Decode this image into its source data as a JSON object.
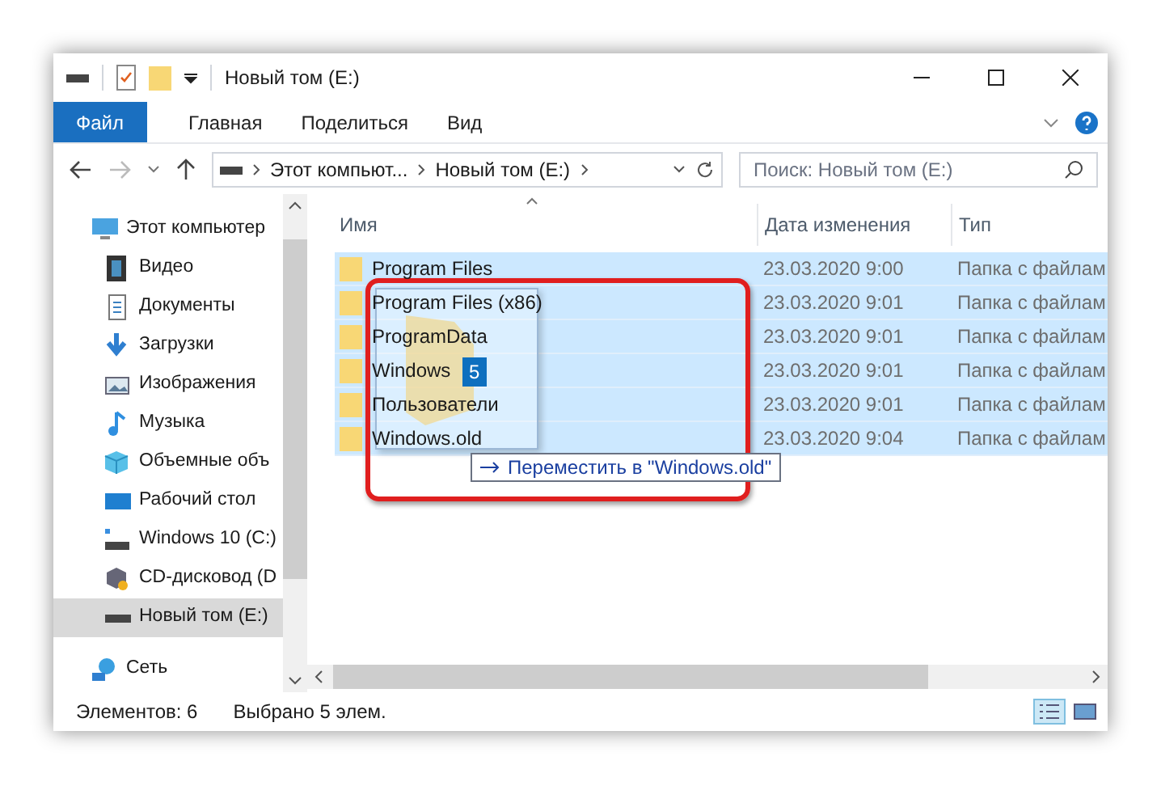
{
  "window": {
    "title": "Новый том (E:)"
  },
  "ribbon": {
    "tabs": [
      {
        "label": "Файл",
        "selected": true
      },
      {
        "label": "Главная",
        "selected": false
      },
      {
        "label": "Поделиться",
        "selected": false
      },
      {
        "label": "Вид",
        "selected": false
      }
    ]
  },
  "address_bar": {
    "path": [
      "Этот компьют...",
      "Новый том (E:)"
    ],
    "search": {
      "placeholder": "Поиск: Новый том (E:)"
    }
  },
  "sidebar": {
    "items": [
      {
        "label": "Этот компьютер",
        "kind": "pc",
        "selected": false,
        "children": [
          {
            "label": "Видео",
            "kind": "video",
            "selected": false
          },
          {
            "label": "Документы",
            "kind": "docs",
            "selected": false
          },
          {
            "label": "Загрузки",
            "kind": "down",
            "selected": false
          },
          {
            "label": "Изображения",
            "kind": "image",
            "selected": false
          },
          {
            "label": "Музыка",
            "kind": "music",
            "selected": false
          },
          {
            "label": "Объемные объ",
            "kind": "cube",
            "selected": false
          },
          {
            "label": "Рабочий стол",
            "kind": "desk",
            "selected": false
          },
          {
            "label": "Windows 10 (C:)",
            "kind": "sysdrive",
            "selected": false
          },
          {
            "label": "CD-дисковод (D",
            "kind": "cd",
            "selected": false
          },
          {
            "label": "Новый том (E:)",
            "kind": "drive",
            "selected": true
          }
        ]
      },
      {
        "label": "Сеть",
        "kind": "net",
        "selected": false
      }
    ]
  },
  "table": {
    "columns": [
      "Имя",
      "Дата изменения",
      "Тип"
    ],
    "rows": [
      {
        "name": "Program Files",
        "date": "23.03.2020 9:00",
        "type": "Папка с файлам",
        "selected": true
      },
      {
        "name": "Program Files (x86)",
        "date": "23.03.2020 9:01",
        "type": "Папка с файлам",
        "selected": true
      },
      {
        "name": "ProgramData",
        "date": "23.03.2020 9:01",
        "type": "Папка с файлам",
        "selected": true
      },
      {
        "name": "Windows",
        "date": "23.03.2020 9:01",
        "type": "Папка с файлам",
        "selected": true
      },
      {
        "name": "Пользователи",
        "date": "23.03.2020 9:01",
        "type": "Папка с файлам",
        "selected": true
      },
      {
        "name": "Windows.old",
        "date": "23.03.2020 9:04",
        "type": "Папка с файлам",
        "selected": true
      }
    ]
  },
  "drag": {
    "count": "5",
    "tooltip": "Переместить в \"Windows.old\""
  },
  "status_bar": {
    "items": "Элементов: 6",
    "selected": "Выбрано 5 элем."
  }
}
